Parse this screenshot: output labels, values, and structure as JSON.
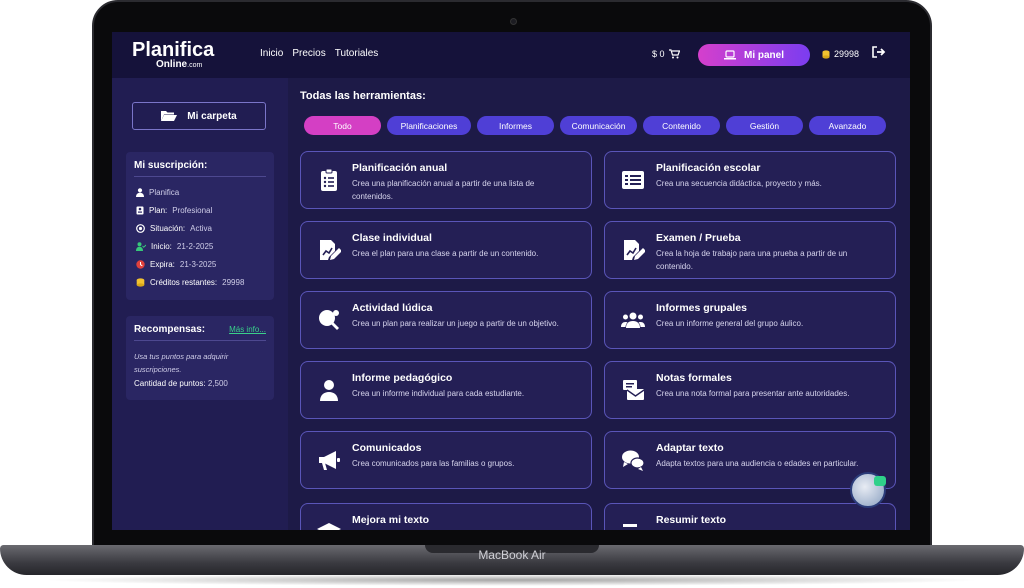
{
  "device": {
    "label": "MacBook Air"
  },
  "header": {
    "logo_main": "Planifica",
    "logo_sub": "Online",
    "logo_tld": ".com",
    "nav": [
      "Inicio",
      "Precios",
      "Tutoriales"
    ],
    "cart_amount": "$ 0",
    "panel_button": "Mi panel",
    "credits": "29998",
    "accent_gradient": [
      "#d53fcc",
      "#7b3df0"
    ]
  },
  "sidebar": {
    "folder_button": "Mi carpeta",
    "subscription": {
      "title": "Mi suscripción:",
      "rows": [
        {
          "label": "",
          "value": "Planifica",
          "icon": "user-icon"
        },
        {
          "label": "Plan:",
          "value": "Profesional",
          "icon": "id-card-icon"
        },
        {
          "label": "Situación:",
          "value": "Activa",
          "icon": "status-circle-icon"
        },
        {
          "label": "Inicio:",
          "value": "21-2-2025",
          "icon": "user-check-icon"
        },
        {
          "label": "Expira:",
          "value": "21-3-2025",
          "icon": "clock-icon"
        },
        {
          "label": "Créditos restantes:",
          "value": "29998",
          "icon": "coins-icon"
        }
      ]
    },
    "rewards": {
      "title": "Recompensas:",
      "link": "Más info...",
      "text": "Usa tus puntos para adquirir suscripciones.",
      "points_label": "Cantidad de puntos:",
      "points_value": "2,500"
    }
  },
  "main": {
    "title": "Todas las herramientas:",
    "filters": [
      "Todo",
      "Planificaciones",
      "Informes",
      "Comunicación",
      "Contenido",
      "Gestión",
      "Avanzado"
    ],
    "active_filter": "Todo",
    "tools": [
      {
        "title": "Planificación anual",
        "desc": "Crea una planificación anual a partir de una lista de contenidos.",
        "icon": "clipboard-list-icon"
      },
      {
        "title": "Planificación escolar",
        "desc": "Crea una secuencia didáctica, proyecto y más.",
        "icon": "list-icon"
      },
      {
        "title": "Clase individual",
        "desc": "Crea el plan para una clase a partir de un contenido.",
        "icon": "edit-document-icon"
      },
      {
        "title": "Examen / Prueba",
        "desc": "Crea la hoja de trabajo para una prueba a partir de un contenido.",
        "icon": "edit-document-icon"
      },
      {
        "title": "Actividad lúdica",
        "desc": "Crea un plan para realizar un juego a partir de un objetivo.",
        "icon": "ping-pong-icon"
      },
      {
        "title": "Informes grupales",
        "desc": "Crea un informe general del grupo áulico.",
        "icon": "users-icon"
      },
      {
        "title": "Informe pedagógico",
        "desc": "Crea un informe individual para cada estudiante.",
        "icon": "user-icon"
      },
      {
        "title": "Notas formales",
        "desc": "Crea una nota formal para presentar ante autoridades.",
        "icon": "envelope-icon"
      },
      {
        "title": "Comunicados",
        "desc": "Crea comunicados para las familias o grupos.",
        "icon": "megaphone-icon"
      },
      {
        "title": "Adaptar texto",
        "desc": "Adapta textos para una audiencia o edades en particular.",
        "icon": "chat-bubbles-icon"
      },
      {
        "title": "Mejora mi texto",
        "desc": "",
        "icon": "graduation-cap-icon"
      },
      {
        "title": "Resumir texto",
        "desc": "",
        "icon": "align-left-icon"
      }
    ]
  }
}
